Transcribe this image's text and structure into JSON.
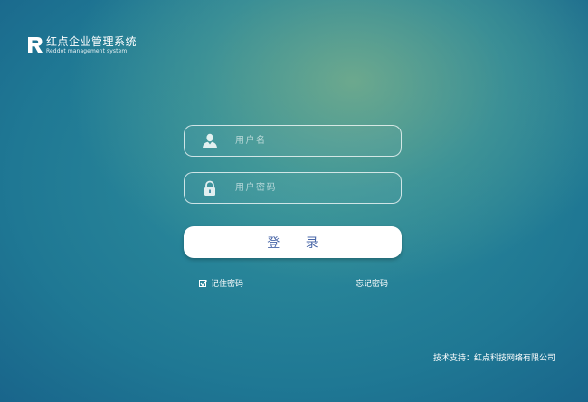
{
  "brand": {
    "logo_letter": "R",
    "title": "红点企业管理系统",
    "subtitle": "Reddot management system"
  },
  "login_form": {
    "username": {
      "placeholder": "用户名",
      "value": "",
      "icon": "user-icon"
    },
    "password": {
      "placeholder": "用户密码",
      "value": "",
      "icon": "lock-icon"
    },
    "submit_label": "登 录",
    "remember": {
      "label": "记住密码",
      "checked": true
    },
    "forgot_label": "忘记密码"
  },
  "footer": {
    "text": "技术支持：红点科技网络有限公司"
  },
  "colors": {
    "background_top": "#6fa890",
    "background_bottom": "#10467a",
    "button_text": "#4a67a8",
    "field_border": "#ffffff"
  }
}
